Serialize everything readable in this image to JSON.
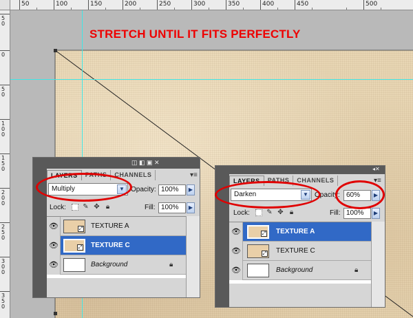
{
  "headline": "STRETCH UNTIL IT FITS PERFECTLY",
  "ruler_top_labels": [
    "50",
    "100",
    "150",
    "200",
    "250",
    "300",
    "350",
    "400",
    "450",
    "500"
  ],
  "ruler_left_labels": [
    "50",
    "0",
    "50",
    "100",
    "150",
    "200",
    "250",
    "300",
    "350"
  ],
  "panel_left": {
    "tabs": [
      "LAYERS",
      "PATHS",
      "CHANNELS"
    ],
    "blend_mode": "Multiply",
    "opacity_label": "Opacity:",
    "opacity_value": "100%",
    "lock_label": "Lock:",
    "fill_label": "Fill:",
    "fill_value": "100%",
    "layers": [
      {
        "name": "TEXTURE A",
        "selected": false,
        "italic": false
      },
      {
        "name": "TEXTURE C",
        "selected": true,
        "italic": false
      },
      {
        "name": "Background",
        "selected": false,
        "italic": true
      }
    ]
  },
  "panel_right": {
    "tabs": [
      "LAYERS",
      "PATHS",
      "CHANNELS"
    ],
    "blend_mode": "Darken",
    "opacity_label": "Opacity:",
    "opacity_value": "60%",
    "lock_label": "Lock:",
    "fill_label": "Fill:",
    "fill_value": "100%",
    "layers": [
      {
        "name": "TEXTURE A",
        "selected": true,
        "italic": false
      },
      {
        "name": "TEXTURE C",
        "selected": false,
        "italic": false
      },
      {
        "name": "Background",
        "selected": false,
        "italic": true
      }
    ]
  },
  "icons": {
    "eye": "eye-icon",
    "lock": "lock-icon",
    "brush": "brush-icon",
    "move": "move-icon",
    "dropdown": "chevron-down-icon",
    "spin": "chevron-right-icon",
    "panel_menu": "panel-menu-icon"
  },
  "colors": {
    "headline": "#ee0000",
    "selected_row": "#3169c6",
    "guide": "#3ee6e6",
    "highlight_circle": "#e00000"
  }
}
